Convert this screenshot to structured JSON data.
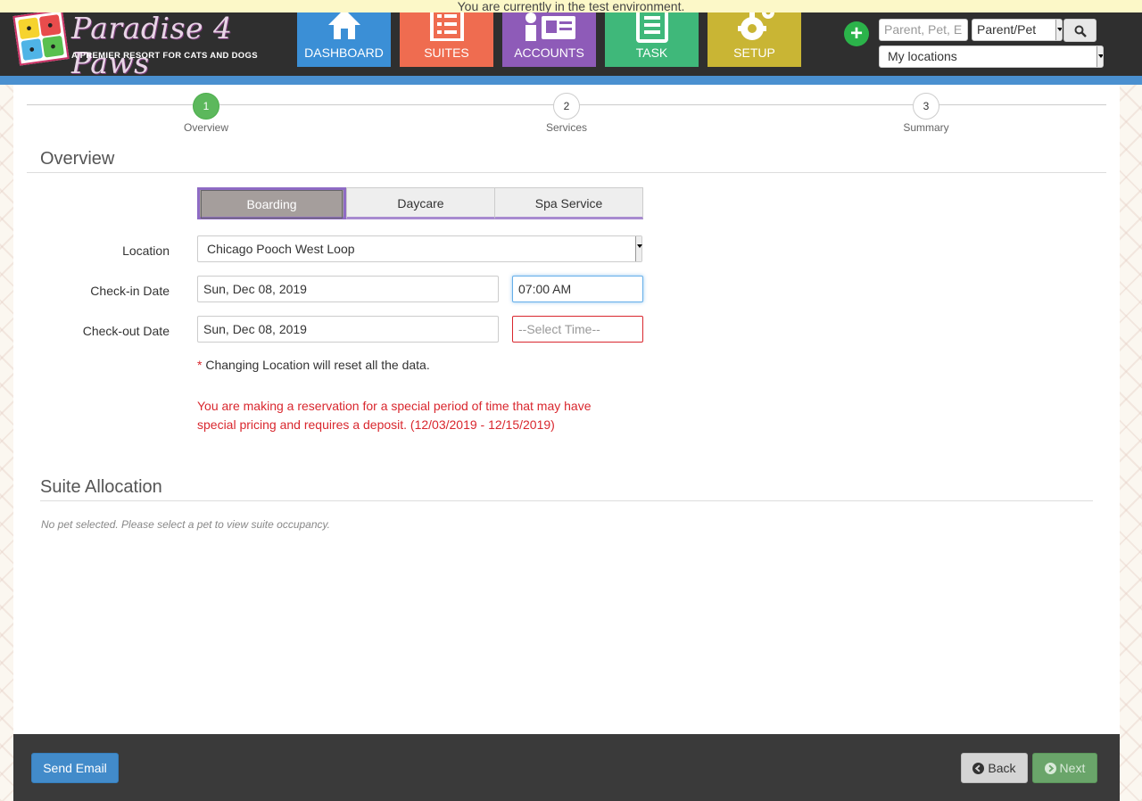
{
  "banner": "You are currently in the test environment.",
  "logo": {
    "title": "Paradise 4 Paws",
    "subtitle": "A PREMIER RESORT FOR CATS AND DOGS"
  },
  "nav": [
    {
      "label": "DASHBOARD",
      "color": "#3b8fd6",
      "icon": "dashboard-house-icon"
    },
    {
      "label": "SUITES",
      "color": "#ef6c50",
      "icon": "suites-list-icon"
    },
    {
      "label": "ACCOUNTS",
      "color": "#8e5bb8",
      "icon": "accounts-card-icon"
    },
    {
      "label": "TASK",
      "color": "#3fb87a",
      "icon": "task-clipboard-icon"
    },
    {
      "label": "SETUP",
      "color": "#c9b534",
      "icon": "setup-gear-icon"
    }
  ],
  "header": {
    "search_placeholder": "Parent, Pet, E",
    "search_type": "Parent/Pet",
    "locations": "My locations"
  },
  "steps": [
    {
      "num": "1",
      "name": "Overview"
    },
    {
      "num": "2",
      "name": "Services"
    },
    {
      "num": "3",
      "name": "Summary"
    }
  ],
  "overview": {
    "title": "Overview",
    "service_types": [
      "Boarding",
      "Daycare",
      "Spa Service"
    ],
    "location_label": "Location",
    "location_value": "Chicago Pooch West Loop",
    "checkin_label": "Check-in Date",
    "checkin_date": "Sun, Dec 08, 2019",
    "checkin_time": "07:00 AM",
    "checkout_label": "Check-out Date",
    "checkout_date": "Sun, Dec 08, 2019",
    "checkout_time_placeholder": "--Select Time--",
    "asterisk": "*",
    "note": "Changing Location will reset all the data.",
    "warning": "You are making a reservation for a special period of time that may have special pricing and requires a deposit. (12/03/2019 - 12/15/2019)"
  },
  "suite": {
    "title": "Suite Allocation",
    "hint": "No pet selected. Please select a pet to view suite occupancy."
  },
  "footer": {
    "send_email": "Send Email",
    "back": "Back",
    "next": "Next"
  }
}
